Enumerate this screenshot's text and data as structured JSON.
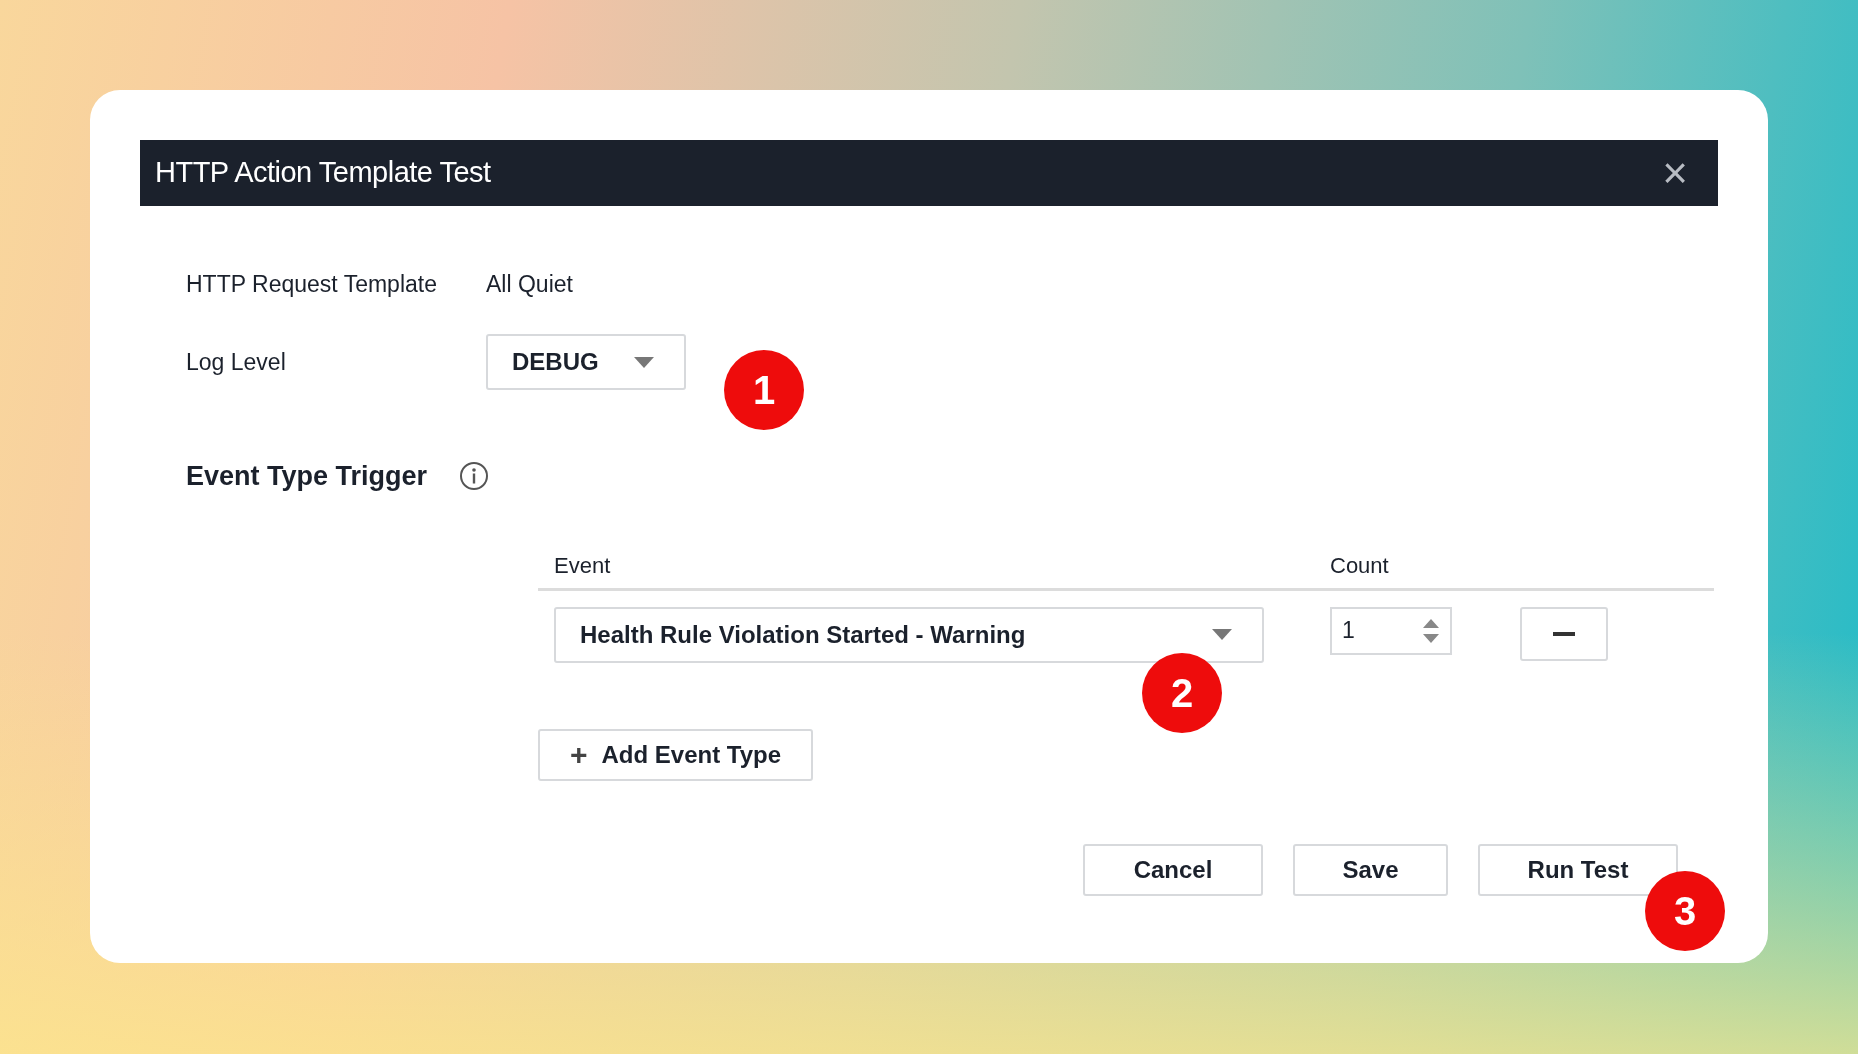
{
  "dialog": {
    "title": "HTTP Action Template Test",
    "close_icon": "×"
  },
  "fields": [
    {
      "label": "HTTP Request Template",
      "kind": "text",
      "value": "All Quiet"
    },
    {
      "label": "Log Level",
      "kind": "dropdown",
      "value": "DEBUG",
      "callout": "1"
    }
  ],
  "section": {
    "title": "Event Type Trigger"
  },
  "table": {
    "columns": [
      "Event",
      "Count"
    ],
    "rows": [
      {
        "event": "Health Rule Violation Started - Warning",
        "count": "1",
        "callout": "2"
      }
    ]
  },
  "add_button": {
    "icon": "+",
    "label": "Add Event Type"
  },
  "buttons": [
    {
      "label": "Cancel"
    },
    {
      "label": "Save"
    },
    {
      "label": "Run Test",
      "callout": "3"
    }
  ]
}
